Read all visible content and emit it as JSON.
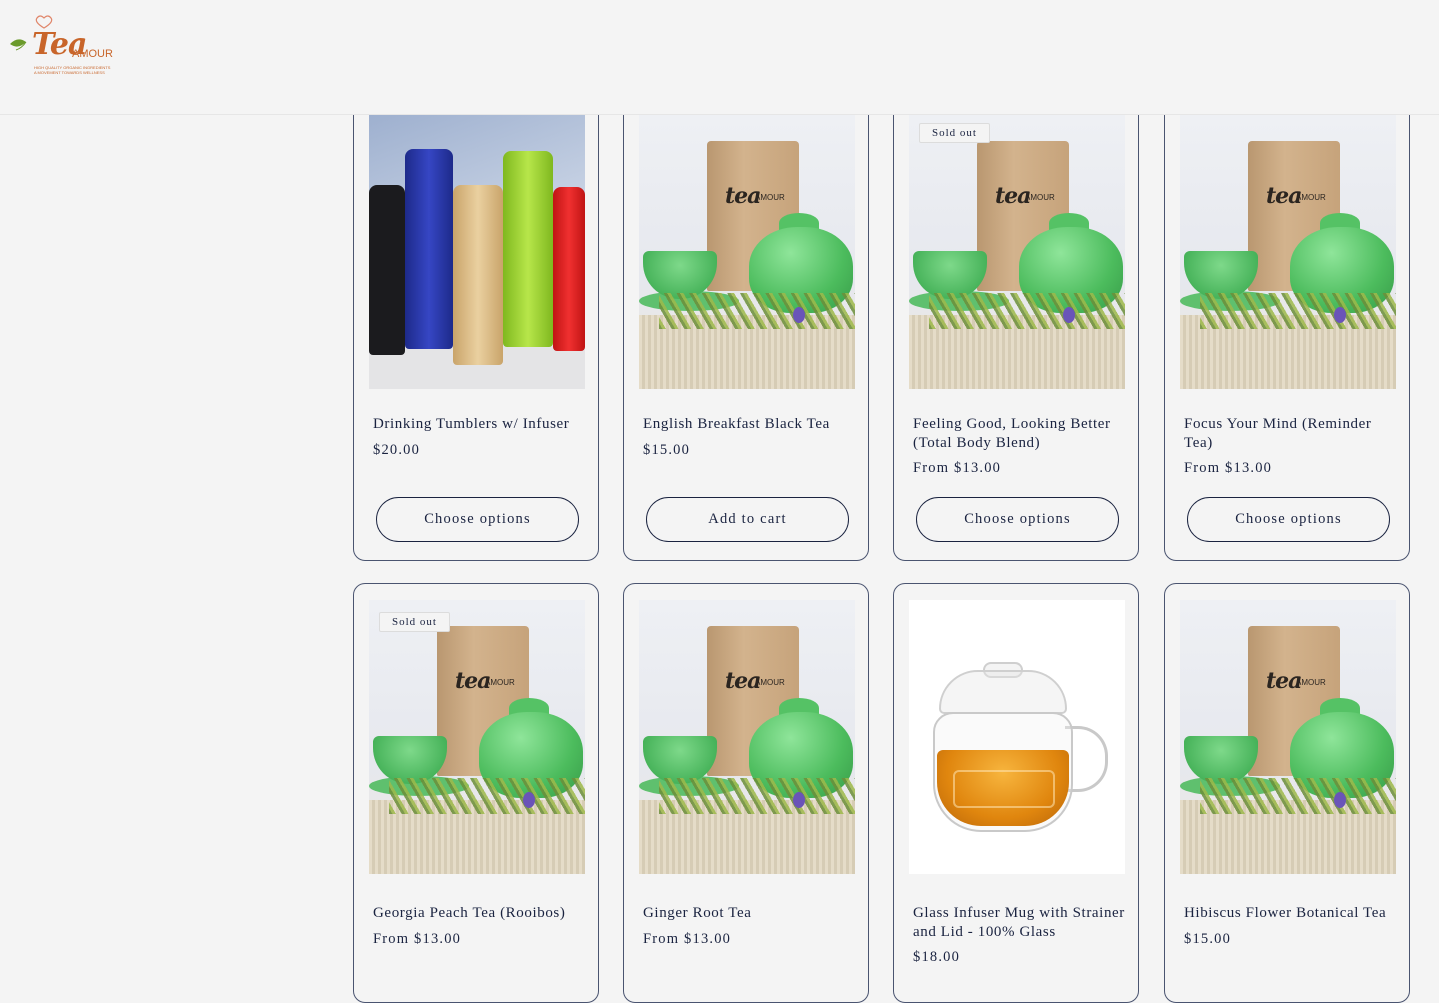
{
  "brand": {
    "logo_word": "Tea",
    "logo_word2": "AMOUR",
    "tagline1": "HIGH QUALITY ORGANIC INGREDIENTS",
    "tagline2": "A MOVEMENT TOWARDS WELLNESS"
  },
  "colors": {
    "brand_orange": "#c8652a",
    "text_navy": "#1a2340",
    "card_border": "#4a5470",
    "background": "#f4f4f4"
  },
  "products": [
    {
      "title": "Drinking Tumblers w/ Infuser",
      "price": "$20.00",
      "button": "Choose options",
      "badge": "",
      "image": "tumblers"
    },
    {
      "title": "English Breakfast Black Tea",
      "price": "$15.00",
      "button": "Add to cart",
      "badge": "",
      "image": "tea-pouch"
    },
    {
      "title": "Feeling Good, Looking Better (Total Body Blend)",
      "price": "From $13.00",
      "button": "Choose options",
      "badge": "Sold out",
      "image": "tea-pouch"
    },
    {
      "title": "Focus Your Mind (Reminder Tea)",
      "price": "From $13.00",
      "button": "Choose options",
      "badge": "",
      "image": "tea-pouch"
    },
    {
      "title": "Georgia Peach Tea (Rooibos)",
      "price": "From $13.00",
      "button": "",
      "badge": "Sold out",
      "image": "tea-pouch"
    },
    {
      "title": "Ginger Root Tea",
      "price": "From $13.00",
      "button": "",
      "badge": "",
      "image": "tea-pouch"
    },
    {
      "title": "Glass Infuser Mug with Strainer and Lid - 100% Glass",
      "price": "$18.00",
      "button": "",
      "badge": "",
      "image": "glass-mug"
    },
    {
      "title": "Hibiscus Flower Botanical Tea",
      "price": "$15.00",
      "button": "",
      "badge": "",
      "image": "tea-pouch"
    }
  ]
}
